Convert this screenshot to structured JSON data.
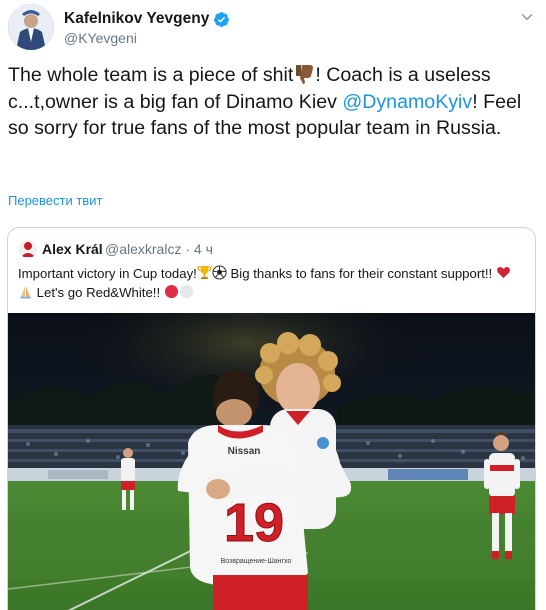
{
  "tweet": {
    "display_name": "Kafelnikov Yevgeny",
    "handle": "@KYevgeni",
    "text_part1": "The whole team is a piece of shit",
    "text_part2": "! Coach is a useless c...t,owner is a big fan of Dinamo Kiev ",
    "mention": "@DynamoKyiv",
    "text_part3": "! Feel so sorry for true fans of the most popular team in Russia.",
    "translate_label": "Перевести твит"
  },
  "quoted": {
    "display_name": "Alex Král",
    "meta": "@alexkralcz · 4 ч",
    "text_part1": "Important victory in Cup today!",
    "text_part2": " Big thanks to fans for their constant support!! ",
    "text_part3": " Let's go Red&White!! "
  },
  "photo": {
    "jersey_number": "19",
    "sponsor_text": "Nissan",
    "sleeve_text": "Возвращение-Шангхо"
  },
  "colors": {
    "mention_blue": "#1b95e0",
    "spartak_red": "#d7141a",
    "heart_red": "#e0245e"
  }
}
